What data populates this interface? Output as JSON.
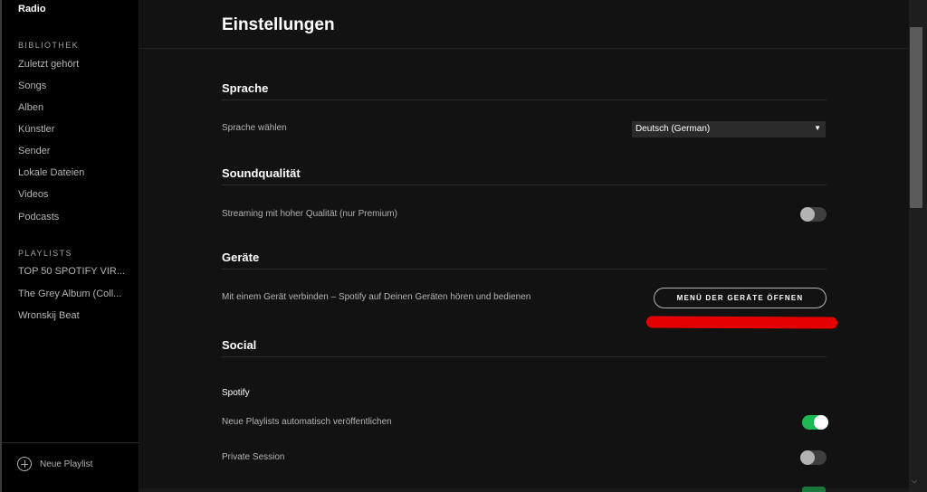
{
  "sidebar": {
    "radio": "Radio",
    "library_heading": "BIBLIOTHEK",
    "library_items": [
      "Zuletzt gehört",
      "Songs",
      "Alben",
      "Künstler",
      "Sender",
      "Lokale Dateien",
      "Videos",
      "Podcasts"
    ],
    "playlists_heading": "PLAYLISTS",
    "playlists": [
      "TOP 50 SPOTIFY VIR...",
      "The Grey Album (Coll...",
      "Wronskij Beat"
    ],
    "new_playlist": "Neue Playlist"
  },
  "settings": {
    "title": "Einstellungen",
    "language": {
      "heading": "Sprache",
      "label": "Sprache wählen",
      "selected": "Deutsch (German)",
      "arrow": "▼"
    },
    "sound": {
      "heading": "Soundqualität",
      "label": "Streaming mit hoher Qualität (nur Premium)",
      "enabled": false
    },
    "devices": {
      "heading": "Geräte",
      "label": "Mit einem Gerät verbinden – Spotify auf Deinen Geräten hören und bedienen",
      "button": "MENÜ DER GERÄTE ÖFFNEN"
    },
    "social": {
      "heading": "Social",
      "subheading": "Spotify",
      "auto_publish_label": "Neue Playlists automatisch veröffentlichen",
      "auto_publish_enabled": true,
      "private_session_label": "Private Session",
      "private_session_enabled": false
    }
  },
  "colors": {
    "accent": "#1db954",
    "annotation_red": "#e50000",
    "background": "#121212",
    "sidebar": "#000000"
  },
  "icons": {
    "new_playlist": "plus-circle-icon",
    "dropdown": "caret-down-icon",
    "scroll_down": "chevron-down-icon"
  }
}
